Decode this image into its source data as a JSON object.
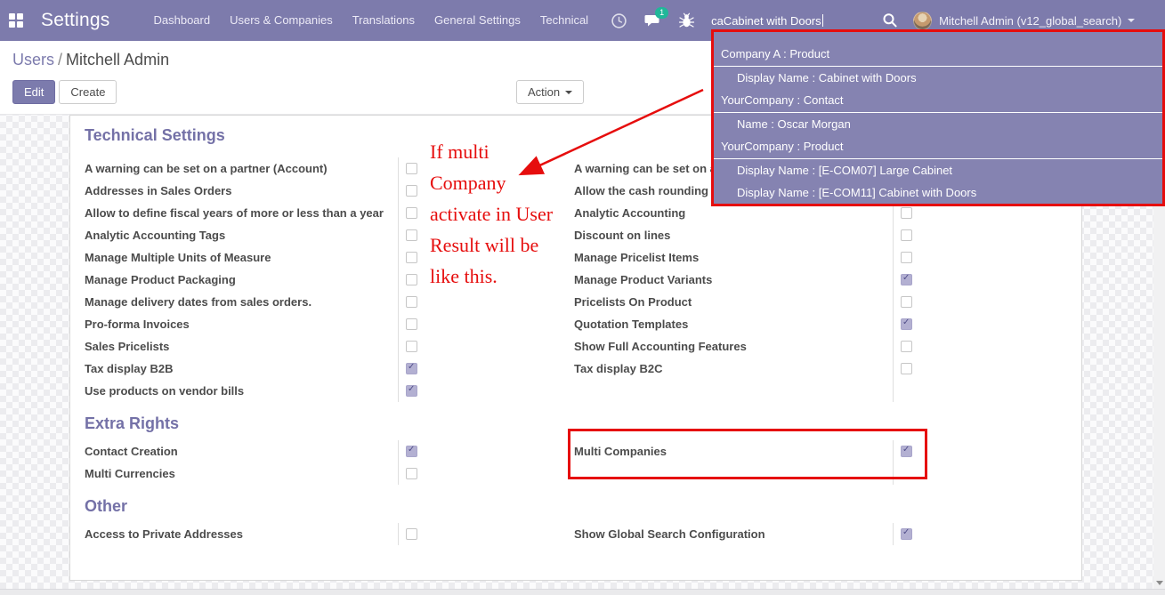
{
  "navbar": {
    "app_title": "Settings",
    "menu_items": [
      "Dashboard",
      "Users & Companies",
      "Translations",
      "General Settings",
      "Technical"
    ],
    "messages_badge": "1",
    "search": {
      "value": "caCabinet with Doors"
    },
    "user": {
      "name": "Mitchell Admin (v12_global_search)"
    },
    "icons": [
      "apps-grid-icon",
      "clock-icon",
      "chat-icon",
      "bug-icon",
      "search-icon",
      "caret-down-icon"
    ]
  },
  "breadcrumb": {
    "parent": "Users",
    "separator": "/",
    "current": "Mitchell Admin"
  },
  "buttons": {
    "edit": "Edit",
    "create": "Create",
    "action": "Action"
  },
  "search_dropdown": {
    "rows": [
      {
        "type": "header",
        "label": "Company A : Product"
      },
      {
        "type": "item",
        "label": "Display Name : Cabinet with Doors"
      },
      {
        "type": "header",
        "label": "YourCompany : Contact"
      },
      {
        "type": "item",
        "label": "Name : Oscar Morgan"
      },
      {
        "type": "header",
        "label": "YourCompany : Product"
      },
      {
        "type": "item",
        "label": "Display Name : [E-COM07] Large Cabinet"
      },
      {
        "type": "item",
        "label": "Display Name : [E-COM11] Cabinet with Doors"
      }
    ]
  },
  "annotation": {
    "lines": [
      "If multi",
      "Company",
      "activate in User",
      "Result will be",
      "like this."
    ]
  },
  "sections": [
    {
      "title": "Technical Settings",
      "left": [
        {
          "label": "A warning can be set on a partner (Account)",
          "checked": false
        },
        {
          "label": "Addresses in Sales Orders",
          "checked": false
        },
        {
          "label": "Allow to define fiscal years of more or less than a year",
          "checked": false
        },
        {
          "label": "Analytic Accounting Tags",
          "checked": false
        },
        {
          "label": "Manage Multiple Units of Measure",
          "checked": false
        },
        {
          "label": "Manage Product Packaging",
          "checked": false
        },
        {
          "label": "Manage delivery dates from sales orders.",
          "checked": false
        },
        {
          "label": "Pro-forma Invoices",
          "checked": false
        },
        {
          "label": "Sales Pricelists",
          "checked": false
        },
        {
          "label": "Tax display B2B",
          "checked": true
        },
        {
          "label": "Use products on vendor bills",
          "checked": true
        }
      ],
      "right": [
        {
          "label": "A warning can be set on a",
          "checked": false
        },
        {
          "label": "Allow the cash rounding r",
          "checked": false
        },
        {
          "label": "Analytic Accounting",
          "checked": false
        },
        {
          "label": "Discount on lines",
          "checked": false
        },
        {
          "label": "Manage Pricelist Items",
          "checked": false
        },
        {
          "label": "Manage Product Variants",
          "checked": true
        },
        {
          "label": "Pricelists On Product",
          "checked": false
        },
        {
          "label": "Quotation Templates",
          "checked": true
        },
        {
          "label": "Show Full Accounting Features",
          "checked": false
        },
        {
          "label": "Tax display B2C",
          "checked": false
        }
      ]
    },
    {
      "title": "Extra Rights",
      "left": [
        {
          "label": "Contact Creation",
          "checked": true
        },
        {
          "label": "Multi Currencies",
          "checked": false
        }
      ],
      "right": [
        {
          "label": "Multi Companies",
          "checked": true
        }
      ]
    },
    {
      "title": "Other",
      "left": [
        {
          "label": "Access to Private Addresses",
          "checked": false
        }
      ],
      "right": [
        {
          "label": "Show Global Search Configuration",
          "checked": true
        }
      ]
    }
  ],
  "colors": {
    "navbar_bg": "#7d7bac",
    "dropdown_bg": "#8583b1",
    "accent": "#7c7bad",
    "annotation_red": "#e60d0d",
    "badge_green": "#21b799",
    "checked_checkbox": "#b3b0d2"
  }
}
